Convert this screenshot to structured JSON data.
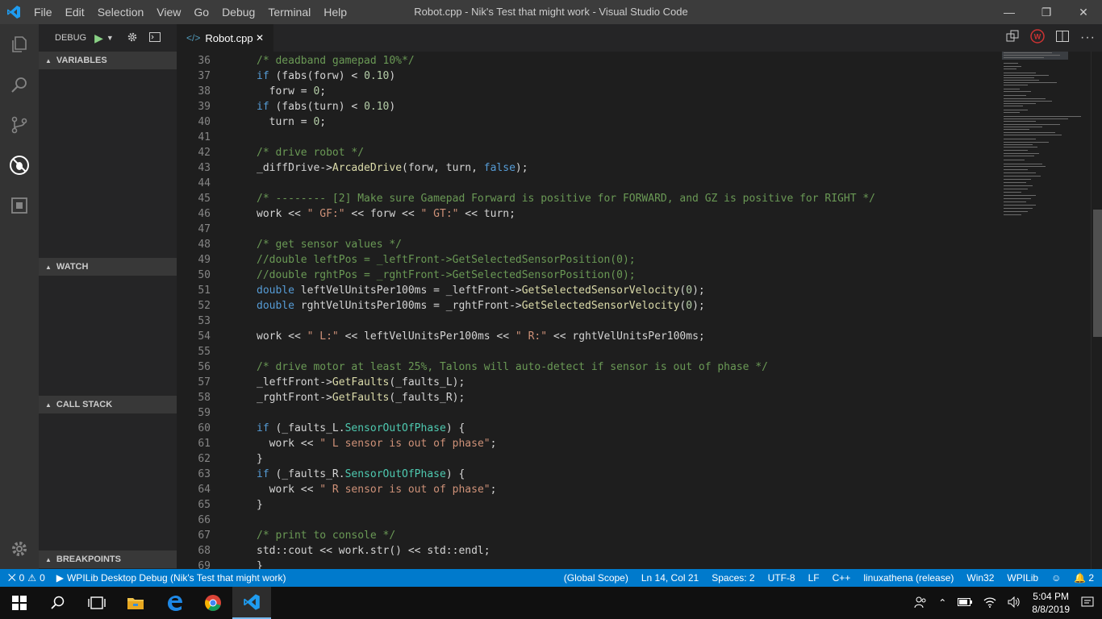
{
  "titlebar": {
    "menus": [
      "File",
      "Edit",
      "Selection",
      "View",
      "Go",
      "Debug",
      "Terminal",
      "Help"
    ],
    "title": "Robot.cpp - Nik's Test that might work - Visual Studio Code"
  },
  "sidebar": {
    "debug_label": "DEBUG",
    "sections": {
      "variables": "VARIABLES",
      "watch": "WATCH",
      "call_stack": "CALL STACK",
      "breakpoints": "BREAKPOINTS"
    }
  },
  "tab": {
    "label": "Robot.cpp"
  },
  "code": {
    "lines": [
      {
        "n": "36",
        "parts": [
          [
            "c",
            "/* deadband gamepad 10%*/"
          ]
        ]
      },
      {
        "n": "37",
        "parts": [
          [
            "k",
            "if"
          ],
          [
            "p",
            " (fabs(forw) < "
          ],
          [
            "n",
            "0.10"
          ],
          [
            "p",
            ")"
          ]
        ]
      },
      {
        "n": "38",
        "parts": [
          [
            "p",
            "  forw = "
          ],
          [
            "n",
            "0"
          ],
          [
            "p",
            ";"
          ]
        ]
      },
      {
        "n": "39",
        "parts": [
          [
            "k",
            "if"
          ],
          [
            "p",
            " (fabs(turn) < "
          ],
          [
            "n",
            "0.10"
          ],
          [
            "p",
            ")"
          ]
        ]
      },
      {
        "n": "40",
        "parts": [
          [
            "p",
            "  turn = "
          ],
          [
            "n",
            "0"
          ],
          [
            "p",
            ";"
          ]
        ]
      },
      {
        "n": "41",
        "parts": []
      },
      {
        "n": "42",
        "parts": [
          [
            "c",
            "/* drive robot */"
          ]
        ]
      },
      {
        "n": "43",
        "parts": [
          [
            "p",
            "_diffDrive->"
          ],
          [
            "f",
            "ArcadeDrive"
          ],
          [
            "p",
            "(forw, turn, "
          ],
          [
            "k",
            "false"
          ],
          [
            "p",
            ");"
          ]
        ]
      },
      {
        "n": "44",
        "parts": []
      },
      {
        "n": "45",
        "parts": [
          [
            "c",
            "/* -------- [2] Make sure Gamepad Forward is positive for FORWARD, and GZ is positive for RIGHT */"
          ]
        ]
      },
      {
        "n": "46",
        "parts": [
          [
            "p",
            "work << "
          ],
          [
            "s",
            "\" GF:\""
          ],
          [
            "p",
            " << forw << "
          ],
          [
            "s",
            "\" GT:\""
          ],
          [
            "p",
            " << turn;"
          ]
        ]
      },
      {
        "n": "47",
        "parts": []
      },
      {
        "n": "48",
        "parts": [
          [
            "c",
            "/* get sensor values */"
          ]
        ]
      },
      {
        "n": "49",
        "parts": [
          [
            "c",
            "//double leftPos = _leftFront->GetSelectedSensorPosition(0);"
          ]
        ]
      },
      {
        "n": "50",
        "parts": [
          [
            "c",
            "//double rghtPos = _rghtFront->GetSelectedSensorPosition(0);"
          ]
        ]
      },
      {
        "n": "51",
        "parts": [
          [
            "k",
            "double"
          ],
          [
            "p",
            " leftVelUnitsPer100ms = _leftFront->"
          ],
          [
            "f",
            "GetSelectedSensorVelocity"
          ],
          [
            "p",
            "("
          ],
          [
            "n",
            "0"
          ],
          [
            "p",
            ");"
          ]
        ]
      },
      {
        "n": "52",
        "parts": [
          [
            "k",
            "double"
          ],
          [
            "p",
            " rghtVelUnitsPer100ms = _rghtFront->"
          ],
          [
            "f",
            "GetSelectedSensorVelocity"
          ],
          [
            "p",
            "("
          ],
          [
            "n",
            "0"
          ],
          [
            "p",
            ");"
          ]
        ]
      },
      {
        "n": "53",
        "parts": []
      },
      {
        "n": "54",
        "parts": [
          [
            "p",
            "work << "
          ],
          [
            "s",
            "\" L:\""
          ],
          [
            "p",
            " << leftVelUnitsPer100ms << "
          ],
          [
            "s",
            "\" R:\""
          ],
          [
            "p",
            " << rghtVelUnitsPer100ms;"
          ]
        ]
      },
      {
        "n": "55",
        "parts": []
      },
      {
        "n": "56",
        "parts": [
          [
            "c",
            "/* drive motor at least 25%, Talons will auto-detect if sensor is out of phase */"
          ]
        ]
      },
      {
        "n": "57",
        "parts": [
          [
            "p",
            "_leftFront->"
          ],
          [
            "f",
            "GetFaults"
          ],
          [
            "p",
            "(_faults_L);"
          ]
        ]
      },
      {
        "n": "58",
        "parts": [
          [
            "p",
            "_rghtFront->"
          ],
          [
            "f",
            "GetFaults"
          ],
          [
            "p",
            "(_faults_R);"
          ]
        ]
      },
      {
        "n": "59",
        "parts": []
      },
      {
        "n": "60",
        "parts": [
          [
            "k",
            "if"
          ],
          [
            "p",
            " (_faults_L."
          ],
          [
            "t",
            "SensorOutOfPhase"
          ],
          [
            "p",
            ") {"
          ]
        ]
      },
      {
        "n": "61",
        "parts": [
          [
            "p",
            "  work << "
          ],
          [
            "s",
            "\" L sensor is out of phase\""
          ],
          [
            "p",
            ";"
          ]
        ]
      },
      {
        "n": "62",
        "parts": [
          [
            "p",
            "}"
          ]
        ]
      },
      {
        "n": "63",
        "parts": [
          [
            "k",
            "if"
          ],
          [
            "p",
            " (_faults_R."
          ],
          [
            "t",
            "SensorOutOfPhase"
          ],
          [
            "p",
            ") {"
          ]
        ]
      },
      {
        "n": "64",
        "parts": [
          [
            "p",
            "  work << "
          ],
          [
            "s",
            "\" R sensor is out of phase\""
          ],
          [
            "p",
            ";"
          ]
        ]
      },
      {
        "n": "65",
        "parts": [
          [
            "p",
            "}"
          ]
        ]
      },
      {
        "n": "66",
        "parts": []
      },
      {
        "n": "67",
        "parts": [
          [
            "c",
            "/* print to console */"
          ]
        ]
      },
      {
        "n": "68",
        "parts": [
          [
            "p",
            "std::cout << work.str() << std::endl;"
          ]
        ]
      },
      {
        "n": "69",
        "parts": [
          [
            "p",
            "}"
          ]
        ]
      }
    ]
  },
  "statusbar": {
    "errors": "0",
    "warnings": "0",
    "debug_config": "WPILib Desktop Debug (Nik's Test that might work)",
    "scope": "(Global Scope)",
    "position": "Ln 14, Col 21",
    "spaces": "Spaces: 2",
    "encoding": "UTF-8",
    "eol": "LF",
    "language": "C++",
    "toolchain": "linuxathena (release)",
    "platform": "Win32",
    "wpilib": "WPILib",
    "notifications": "2"
  },
  "taskbar": {
    "time": "5:04 PM",
    "date": "8/8/2019"
  },
  "colors": {
    "statusbar": "#007acc",
    "comment": "#6a9955",
    "keyword": "#569cd6"
  }
}
